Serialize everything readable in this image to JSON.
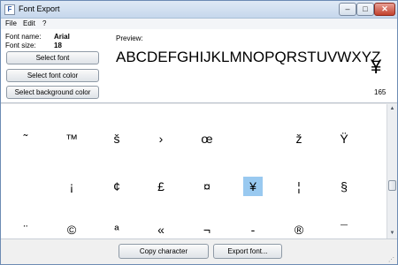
{
  "window": {
    "title": "Font Export"
  },
  "title_buttons": {
    "minimize": "–",
    "maximize": "□",
    "close": "✕"
  },
  "menu": {
    "file": "File",
    "edit": "Edit",
    "help": "?"
  },
  "font": {
    "name_label": "Font name:",
    "name_value": "Arial",
    "size_label": "Font size:",
    "size_value": "18"
  },
  "buttons": {
    "select_font": "Select font",
    "select_font_color": "Select font color",
    "select_background_color": "Select background color",
    "copy_character": "Copy character",
    "export_font": "Export font..."
  },
  "preview": {
    "label": "Preview:",
    "text": "ABCDEFGHIJKLMNOPQRSTUVWXYZ",
    "char": "¥",
    "code": "165"
  },
  "grid": {
    "rows": [
      [
        "˜",
        "™",
        "š",
        "›",
        "œ",
        "",
        "ž",
        "Ÿ"
      ],
      [
        "",
        "¡",
        "¢",
        "£",
        "¤",
        "¥",
        "¦",
        "§"
      ],
      [
        "¨",
        "©",
        "ª",
        "«",
        "¬",
        "-",
        "®",
        "¯"
      ]
    ],
    "selected": {
      "row": 1,
      "col": 5
    }
  },
  "scrollbar": {
    "up": "▲",
    "down": "▼"
  },
  "resize_grip": "⋰"
}
